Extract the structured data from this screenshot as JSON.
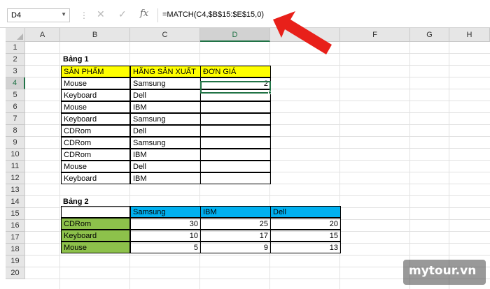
{
  "name_box": "D4",
  "formula": "=MATCH(C4,$B$15:$E$15,0)",
  "columns": [
    "A",
    "B",
    "C",
    "D",
    "E",
    "F",
    "G",
    "H"
  ],
  "rows": [
    "1",
    "2",
    "3",
    "4",
    "5",
    "6",
    "7",
    "8",
    "9",
    "10",
    "11",
    "12",
    "13",
    "14",
    "15",
    "16",
    "17",
    "18",
    "19",
    "20"
  ],
  "table1": {
    "title": "Bảng 1",
    "headers": [
      "SẢN PHẨM",
      "HÃNG SẢN XUẤT",
      "ĐƠN GIÁ"
    ],
    "rows": [
      [
        "Mouse",
        "Samsung",
        "2"
      ],
      [
        "Keyboard",
        "Dell",
        ""
      ],
      [
        "Mouse",
        "IBM",
        ""
      ],
      [
        "Keyboard",
        "Samsung",
        ""
      ],
      [
        "CDRom",
        "Dell",
        ""
      ],
      [
        "CDRom",
        "Samsung",
        ""
      ],
      [
        "CDRom",
        "IBM",
        ""
      ],
      [
        "Mouse",
        "Dell",
        ""
      ],
      [
        "Keyboard",
        "IBM",
        ""
      ]
    ]
  },
  "table2": {
    "title": "Bảng 2",
    "headers": [
      "",
      "Samsung",
      "IBM",
      "Dell"
    ],
    "rows": [
      [
        "CDRom",
        "30",
        "25",
        "20"
      ],
      [
        "Keyboard",
        "10",
        "17",
        "15"
      ],
      [
        "Mouse",
        "5",
        "9",
        "13"
      ]
    ]
  },
  "colors": {
    "yellow_fill": "#ffff00",
    "blue_fill": "#00b0f0",
    "green_fill": "#8dc14b",
    "selection": "#217346",
    "arrow": "#e8201a"
  },
  "icons": {
    "name_box_dropdown": "chevron-down-icon",
    "cancel": "close-icon",
    "enter": "check-icon",
    "function": "fx-icon",
    "pointer": "red-arrow"
  },
  "watermark": "mytour.vn"
}
